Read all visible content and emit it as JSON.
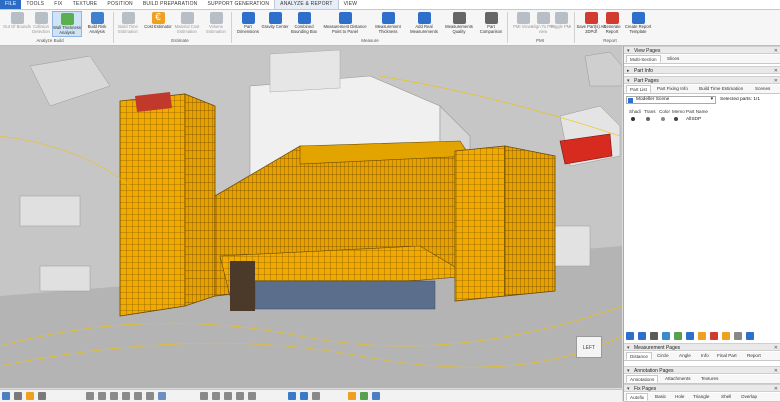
{
  "menu": [
    "FILE",
    "TOOLS",
    "FIX",
    "TEXTURE",
    "POSITION",
    "BUILD PREPARATION",
    "SUPPORT GENERATION",
    "ANALYZE & REPORT",
    "VIEW"
  ],
  "ribbon": {
    "buttons": [
      {
        "label": "Out Of Bounds",
        "state": "disabled",
        "color": "#9aa3ad"
      },
      {
        "label": "Collision Detection",
        "state": "disabled",
        "color": "#9aa3ad"
      },
      {
        "label": "Wall Thickness Analysis",
        "state": "selected",
        "color": "#4caf50"
      },
      {
        "label": "Build Risk Analysis",
        "state": "normal",
        "color": "#3f7fd0"
      },
      {
        "label": "Build Time Estimation",
        "state": "disabled",
        "color": "#9aa3ad"
      },
      {
        "label": "Cost Estimator",
        "state": "normal",
        "color": "#f0a020"
      },
      {
        "label": "Material Cost Estimation",
        "state": "disabled",
        "color": "#9aa3ad"
      },
      {
        "label": "Volume Estimation",
        "state": "disabled",
        "color": "#9aa3ad"
      },
      {
        "label": "Part Dimensions",
        "state": "normal",
        "color": "#2f6fcc"
      },
      {
        "label": "Gravity Center",
        "state": "normal",
        "color": "#2f6fcc"
      },
      {
        "label": "Combined Bounding Box",
        "state": "normal",
        "color": "#2f6fcc"
      },
      {
        "label": "Measurement Distance Point to Panel",
        "state": "normal",
        "color": "#2f6fcc"
      },
      {
        "label": "Measurement Thickness",
        "state": "normal",
        "color": "#2f6fcc"
      },
      {
        "label": "Add Real Measurements",
        "state": "normal",
        "color": "#2f6fcc"
      },
      {
        "label": "Measurements Quality",
        "state": "normal",
        "color": "#555555"
      },
      {
        "label": "Part Comparison",
        "state": "normal",
        "color": "#555555"
      },
      {
        "label": "PMI Views",
        "state": "disabled",
        "color": "#9aa3ad"
      },
      {
        "label": "Align To PMI view",
        "state": "disabled",
        "color": "#9aa3ad"
      },
      {
        "label": "Toggle PMI",
        "state": "disabled",
        "color": "#9aa3ad"
      },
      {
        "label": "Save Part(s) As 3DPdf",
        "state": "normal",
        "color": "#d23b2f"
      },
      {
        "label": "Generate Report",
        "state": "normal",
        "color": "#d23b2f"
      },
      {
        "label": "Create Report Template",
        "state": "normal",
        "color": "#2f6fcc"
      }
    ],
    "groups": [
      "Analyze Build",
      "Estimate",
      "Measure",
      "PMI",
      "Report"
    ]
  },
  "panel": {
    "view_pages": {
      "title": "View Pages",
      "tabs": [
        "Multi-Section",
        "Slices"
      ]
    },
    "part_info": {
      "title": "Part Info"
    },
    "part_pages": {
      "title": "Part Pages",
      "tabs": [
        "Part List",
        "Part Fixing Info",
        "Build Time Estimation",
        "Scenes"
      ],
      "scene": "Modeller Scene",
      "selected_parts_label": "Selected parts: 1/1",
      "columns": [
        "Shadi",
        "Trans",
        "Color",
        "Memo",
        "Part Name"
      ],
      "rows": [
        {
          "name": "AllSDP"
        }
      ]
    },
    "measurement_pages": {
      "title": "Measurement Pages",
      "tabs": [
        "Distance",
        "Circle",
        "Angle",
        "Info",
        "Final Part",
        "Report"
      ]
    },
    "annotation_pages": {
      "title": "Annotation Pages",
      "tabs": [
        "Annotations",
        "Attachments",
        "Textures"
      ]
    },
    "fix_pages": {
      "title": "Fix Pages",
      "tabs": [
        "Autofix",
        "Basic",
        "Hole",
        "Triangle",
        "Shell",
        "Overlap"
      ]
    }
  },
  "viewport": {
    "cube_face": "LEFT"
  },
  "colors": {
    "accent": "#2b6cc4",
    "building": "#f2a900",
    "panel_bg": "#ffffff"
  }
}
